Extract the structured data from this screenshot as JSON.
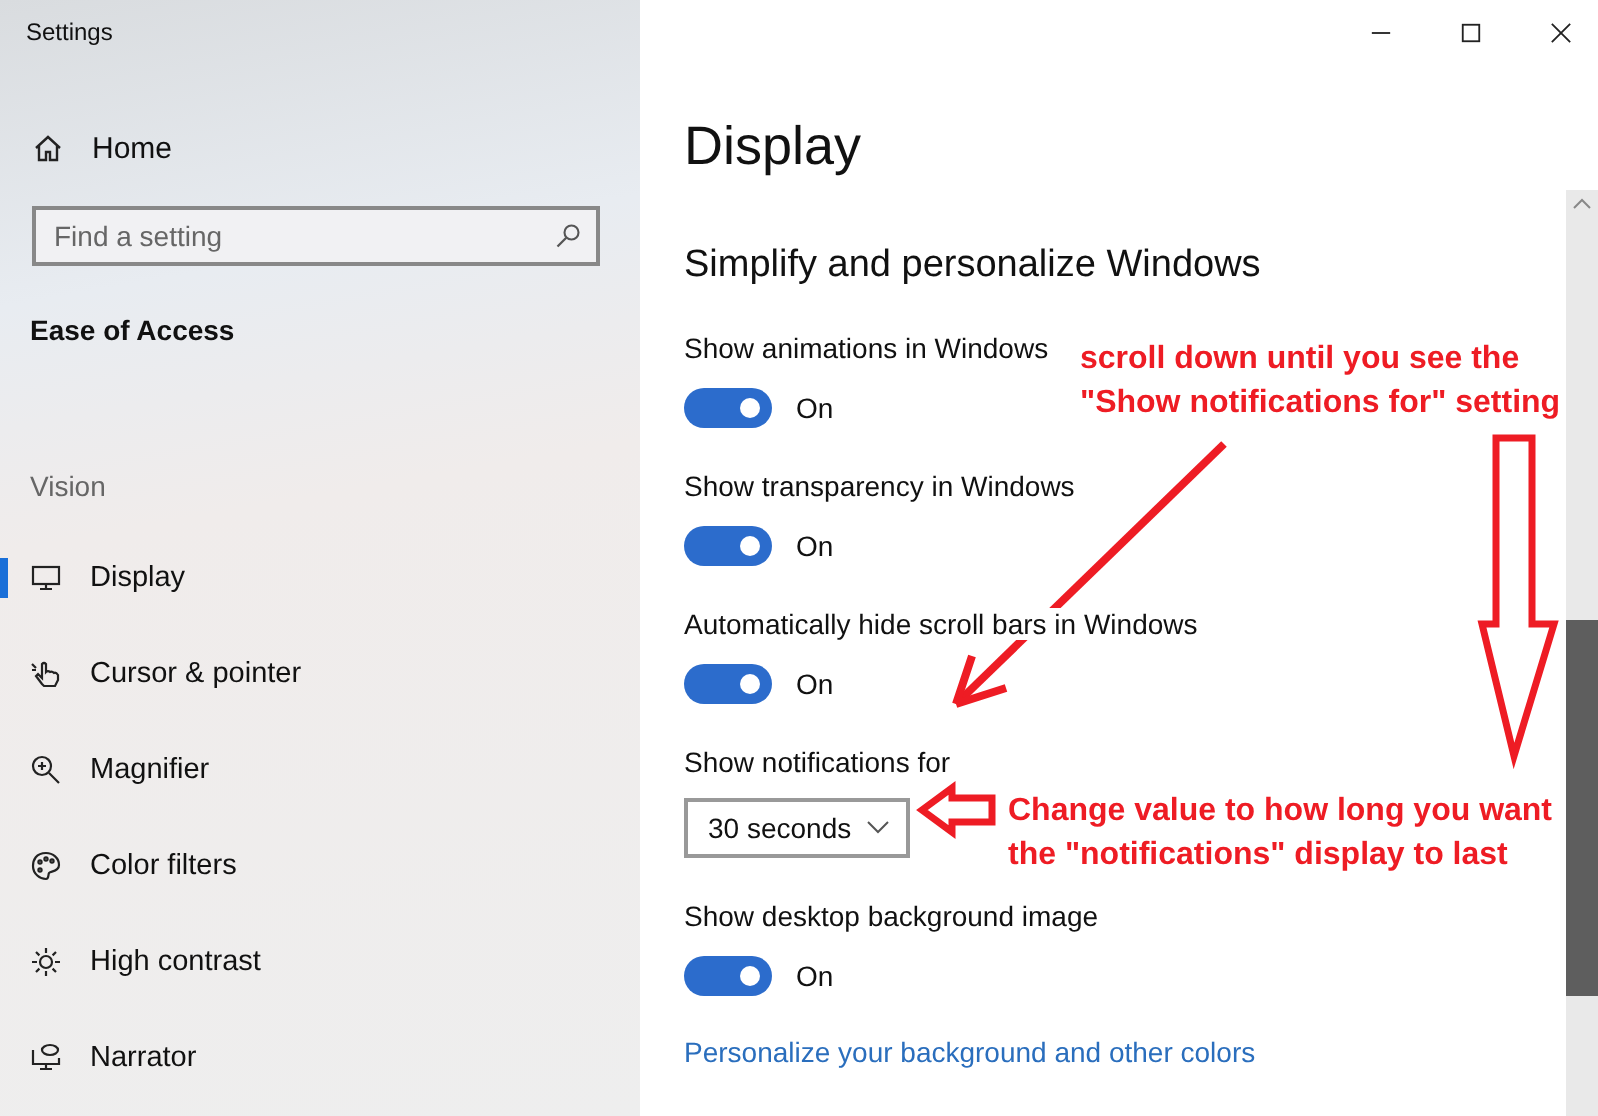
{
  "window": {
    "title": "Settings"
  },
  "sidebar": {
    "home": "Home",
    "search": {
      "placeholder": "Find a setting"
    },
    "section": "Ease of Access",
    "group": "Vision",
    "items": [
      {
        "label": "Display",
        "selected": true
      },
      {
        "label": "Cursor & pointer",
        "selected": false
      },
      {
        "label": "Magnifier",
        "selected": false
      },
      {
        "label": "Color filters",
        "selected": false
      },
      {
        "label": "High contrast",
        "selected": false
      },
      {
        "label": "Narrator",
        "selected": false
      }
    ]
  },
  "page": {
    "title": "Display",
    "subtitle": "Simplify and personalize Windows",
    "settings": [
      {
        "kind": "toggle",
        "label": "Show animations in Windows",
        "on": true,
        "state": "On"
      },
      {
        "kind": "toggle",
        "label": "Show transparency in Windows",
        "on": true,
        "state": "On"
      },
      {
        "kind": "toggle",
        "label": "Automatically hide scroll bars in Windows",
        "on": true,
        "state": "On"
      },
      {
        "kind": "dropdown",
        "label": "Show notifications for",
        "value": "30 seconds"
      },
      {
        "kind": "toggle",
        "label": "Show desktop background image",
        "on": true,
        "state": "On"
      }
    ],
    "link": "Personalize your background and other colors"
  },
  "annotations": [
    {
      "lines": [
        "scroll down until you see the",
        "\"Show notifications for\" setting"
      ]
    },
    {
      "lines": [
        "Change value to how long you want",
        "the \"notifications\" display to last"
      ]
    }
  ]
}
